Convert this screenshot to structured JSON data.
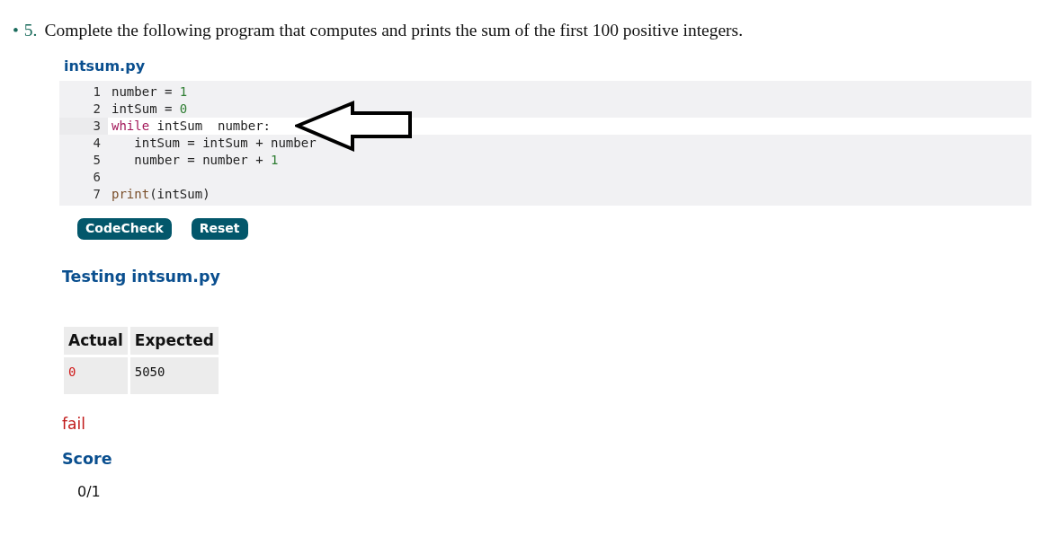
{
  "question": {
    "bullet": "•",
    "number": "5.",
    "text": "Complete the following program that computes and prints the sum of the first 100 positive integers."
  },
  "file_title": "intsum.py",
  "code_lines": [
    {
      "number": "1",
      "active": false,
      "tokens": [
        {
          "kind": "plain",
          "text": "number = "
        },
        {
          "kind": "number",
          "text": "1"
        }
      ]
    },
    {
      "number": "2",
      "active": false,
      "tokens": [
        {
          "kind": "plain",
          "text": "intSum = "
        },
        {
          "kind": "number",
          "text": "0"
        }
      ]
    },
    {
      "number": "3",
      "active": true,
      "tokens": [
        {
          "kind": "keyword",
          "text": "while"
        },
        {
          "kind": "plain",
          "text": " intSum  number:"
        }
      ]
    },
    {
      "number": "4",
      "active": false,
      "tokens": [
        {
          "kind": "plain",
          "text": "   intSum = intSum + number"
        }
      ]
    },
    {
      "number": "5",
      "active": false,
      "tokens": [
        {
          "kind": "plain",
          "text": "   number = number + "
        },
        {
          "kind": "number",
          "text": "1"
        }
      ]
    },
    {
      "number": "6",
      "active": false
    },
    {
      "number": "7",
      "active": false,
      "tokens": [
        {
          "kind": "builtin",
          "text": "print"
        },
        {
          "kind": "plain",
          "text": "(intSum)"
        }
      ]
    }
  ],
  "buttons": [
    "CodeCheck",
    "Reset"
  ],
  "testing_title": "Testing intsum.py",
  "results": {
    "columns": [
      "Actual",
      "Expected"
    ],
    "rows": [
      {
        "cells": [
          {
            "text": "0",
            "mismatch": true
          },
          {
            "text": "5050",
            "mismatch": false
          }
        ]
      }
    ]
  },
  "verdict": {
    "text": "fail",
    "passed": false
  },
  "score_title": "Score",
  "score": "0/1"
}
